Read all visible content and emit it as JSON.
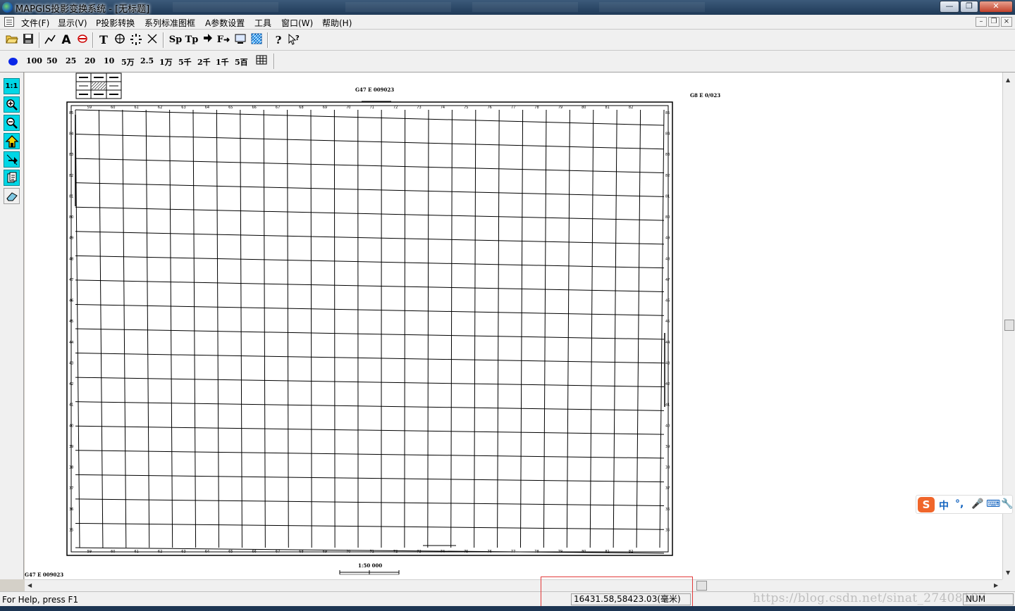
{
  "window": {
    "title": "MAPGIS投影变换系统 - [无标题]",
    "minimize": "—",
    "restore": "❐",
    "close": "✕"
  },
  "menu": {
    "items": [
      "文件(F)",
      "显示(V)",
      "P投影转换",
      "系列标准图框",
      "A参数设置",
      "工具",
      "窗口(W)",
      "帮助(H)"
    ],
    "mdi_minimize": "–",
    "mdi_restore": "❐",
    "mdi_close": "×"
  },
  "toolbar1": {
    "text_tool": "T",
    "sp": "Sp",
    "tp": "Tp",
    "f_arrow": "F",
    "help": "?"
  },
  "toolbar2": {
    "scales": [
      "100",
      "50",
      "25",
      "20",
      "10",
      "5万",
      "2.5",
      "1万",
      "5千",
      "2千",
      "1千",
      "5百"
    ]
  },
  "leftbar": {
    "one_to_one": "1:1"
  },
  "map": {
    "title_top": "G47 E 009023",
    "title_right": "G8 E 0/023",
    "sheet_bottom_left": "G47 E 009023",
    "scale_text": "1:50 000",
    "x_ticks": [
      "59",
      "60",
      "61",
      "62",
      "63",
      "64",
      "65",
      "66",
      "67",
      "68",
      "69",
      "70",
      "71",
      "72",
      "73",
      "74",
      "75",
      "76",
      "77",
      "78",
      "79",
      "80",
      "81",
      "82"
    ],
    "y_ticks": [
      "85",
      "84",
      "83",
      "82",
      "81",
      "80",
      "49",
      "48",
      "47",
      "46",
      "45",
      "44",
      "43",
      "42",
      "41",
      "40",
      "39",
      "38",
      "37",
      "36",
      "35",
      "34"
    ]
  },
  "status": {
    "help": "For Help, press F1",
    "coords": "16431.58,58423.03(毫米)",
    "num": "NUM"
  },
  "ime": {
    "logo": "S",
    "zh": "中",
    "punct": "°,"
  },
  "watermark": "https://blog.csdn.net/sinat_27408107"
}
